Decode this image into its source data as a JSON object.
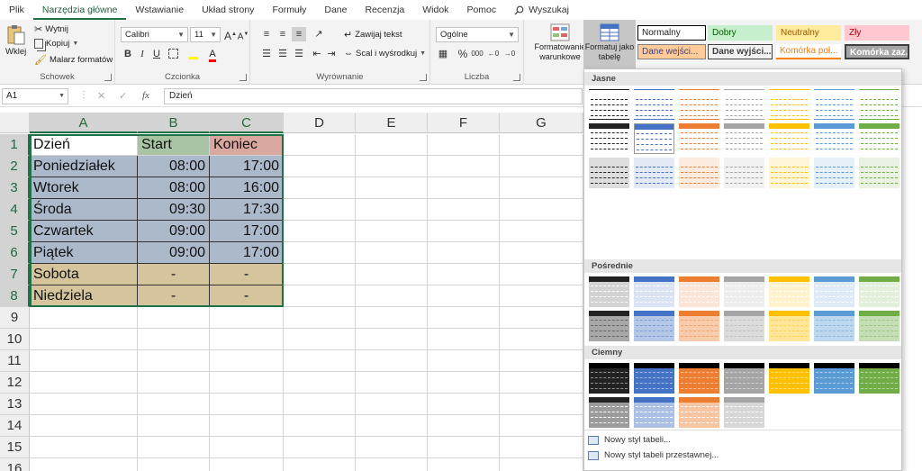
{
  "tabs": [
    {
      "label": "Plik",
      "active": false
    },
    {
      "label": "Narzędzia główne",
      "active": true
    },
    {
      "label": "Wstawianie",
      "active": false
    },
    {
      "label": "Układ strony",
      "active": false
    },
    {
      "label": "Formuły",
      "active": false
    },
    {
      "label": "Dane",
      "active": false
    },
    {
      "label": "Recenzja",
      "active": false
    },
    {
      "label": "Widok",
      "active": false
    },
    {
      "label": "Pomoc",
      "active": false
    }
  ],
  "search_label": "Wyszukaj",
  "ribbon": {
    "clipboard": {
      "paste": "Wklej",
      "cut": "Wytnij",
      "copy": "Kopiuj",
      "painter": "Malarz formatów",
      "label": "Schowek"
    },
    "font": {
      "name": "Calibri",
      "size": "11",
      "bold": "B",
      "italic": "I",
      "underline": "U",
      "font_color_letter": "A",
      "label": "Czcionka"
    },
    "alignment": {
      "wrap": "Zawijaj tekst",
      "merge": "Scal i wyśrodkuj",
      "label": "Wyrównanie"
    },
    "number": {
      "format": "Ogólne",
      "percent": "%",
      "thousands": "000",
      "label": "Liczba"
    },
    "styles": {
      "conditional": "Formatowanie warunkowe",
      "format_table": "Formatuj jako tabelę",
      "cell_styles": [
        {
          "label": "Normalny",
          "bg": "#ffffff",
          "fg": "#000000",
          "border": "#000000"
        },
        {
          "label": "Dobry",
          "bg": "#c6efce",
          "fg": "#006100",
          "border": "#c6efce"
        },
        {
          "label": "Neutralny",
          "bg": "#ffeb9c",
          "fg": "#9c5700",
          "border": "#ffeb9c"
        },
        {
          "label": "Zły",
          "bg": "#ffc7ce",
          "fg": "#9c0006",
          "border": "#ffc7ce"
        },
        {
          "label": "Dane wejści...",
          "bg": "#ffcc99",
          "fg": "#3f3f76",
          "border": "#7f7f7f"
        },
        {
          "label": "Dane wyjści...",
          "bg": "#f2f2f2",
          "fg": "#3f3f3f",
          "border": "#3f3f3f"
        },
        {
          "label": "Komórka poł...",
          "bg": "#ffffff",
          "fg": "#fa7d00",
          "border": "#ff8001"
        },
        {
          "label": "Komórka zaz...",
          "bg": "#a5a5a5",
          "fg": "#ffffff",
          "border": "#3f3f3f"
        }
      ]
    }
  },
  "formula_bar": {
    "name_box": "A1",
    "fx": "fx",
    "content": "Dzień"
  },
  "columns": [
    "A",
    "B",
    "C",
    "D",
    "E",
    "F",
    "G"
  ],
  "rows": [
    "1",
    "2",
    "3",
    "4",
    "5",
    "6",
    "7",
    "8",
    "9",
    "10",
    "11",
    "12",
    "13",
    "14",
    "15",
    "16"
  ],
  "table": [
    {
      "day": "Dzień",
      "start": "Start",
      "end": "Koniec"
    },
    {
      "day": "Poniedziałek",
      "start": "08:00",
      "end": "17:00"
    },
    {
      "day": "Wtorek",
      "start": "08:00",
      "end": "16:00"
    },
    {
      "day": "Środa",
      "start": "09:30",
      "end": "17:30"
    },
    {
      "day": "Czwartek",
      "start": "09:00",
      "end": "17:00"
    },
    {
      "day": "Piątek",
      "start": "09:00",
      "end": "17:00"
    },
    {
      "day": "Sobota",
      "start": "-",
      "end": "-"
    },
    {
      "day": "Niedziela",
      "start": "-",
      "end": "-"
    }
  ],
  "cell_colors": {
    "header_a": "#ffffff",
    "header_b": "#a9c4a4",
    "header_c": "#d9a89e",
    "weekday": "#acb9ca",
    "weekend": "#d5c49c"
  },
  "gallery": {
    "sections": [
      "Jasne",
      "Pośrednie",
      "Ciemny"
    ],
    "palette": [
      "#222222",
      "#4472c4",
      "#ed7d31",
      "#a5a5a5",
      "#ffc000",
      "#5b9bd5",
      "#70ad47"
    ],
    "footer": [
      "Nowy styl tabeli...",
      "Nowy styl tabeli przestawnej..."
    ]
  }
}
